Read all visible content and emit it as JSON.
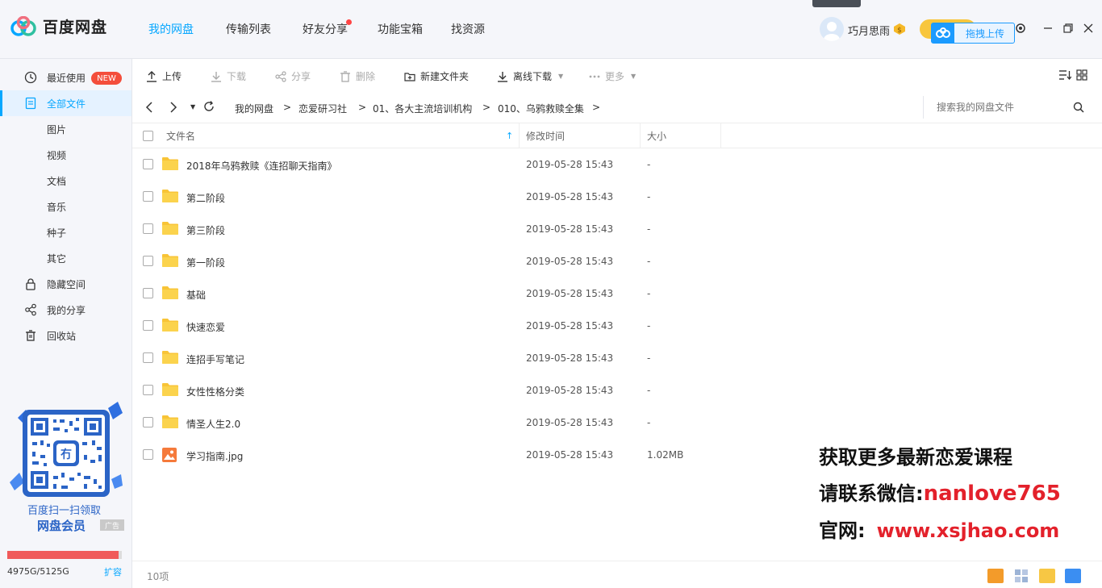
{
  "app": {
    "name": "百度网盘",
    "nav_tabs": [
      "我的网盘",
      "传输列表",
      "好友分享",
      "功能宝箱",
      "找资源"
    ],
    "active_tab": "我的网盘",
    "user": {
      "name": "巧月思雨"
    },
    "upload_float": "拖拽上传"
  },
  "sidebar": {
    "items": [
      {
        "label": "最近使用",
        "badge": "NEW"
      },
      {
        "label": "全部文件"
      },
      {
        "label": "图片"
      },
      {
        "label": "视频"
      },
      {
        "label": "文档"
      },
      {
        "label": "音乐"
      },
      {
        "label": "种子"
      },
      {
        "label": "其它"
      },
      {
        "label": "隐藏空间"
      },
      {
        "label": "我的分享"
      },
      {
        "label": "回收站"
      }
    ],
    "promo": {
      "line1": "百度扫一扫领取",
      "line2": "网盘会员",
      "ad": "广告"
    },
    "quota": {
      "text": "4975G/5125G",
      "used_fraction": 0.971,
      "expand": "扩容"
    }
  },
  "toolbar": {
    "upload": "上传",
    "download": "下载",
    "share": "分享",
    "delete": "删除",
    "new_folder": "新建文件夹",
    "offline_download": "离线下载",
    "more": "更多"
  },
  "breadcrumb": {
    "items": [
      "我的网盘",
      "恋爱研习社",
      "01、各大主流培训机构",
      "010、乌鸦救赎全集"
    ],
    "search_placeholder": "搜索我的网盘文件"
  },
  "table": {
    "headers": {
      "name": "文件名",
      "modified": "修改时间",
      "size": "大小"
    },
    "rows": [
      {
        "name": "2018年乌鸦救赎《连招聊天指南》",
        "modified": "2019-05-28 15:43",
        "size": "-",
        "type": "folder"
      },
      {
        "name": "第二阶段",
        "modified": "2019-05-28 15:43",
        "size": "-",
        "type": "folder"
      },
      {
        "name": "第三阶段",
        "modified": "2019-05-28 15:43",
        "size": "-",
        "type": "folder"
      },
      {
        "name": "第一阶段",
        "modified": "2019-05-28 15:43",
        "size": "-",
        "type": "folder"
      },
      {
        "name": "基础",
        "modified": "2019-05-28 15:43",
        "size": "-",
        "type": "folder"
      },
      {
        "name": "快速恋爱",
        "modified": "2019-05-28 15:43",
        "size": "-",
        "type": "folder"
      },
      {
        "name": "连招手写笔记",
        "modified": "2019-05-28 15:43",
        "size": "-",
        "type": "folder"
      },
      {
        "name": "女性性格分类",
        "modified": "2019-05-28 15:43",
        "size": "-",
        "type": "folder"
      },
      {
        "name": "情圣人生2.0",
        "modified": "2019-05-28 15:43",
        "size": "-",
        "type": "folder"
      },
      {
        "name": "学习指南.jpg",
        "modified": "2019-05-28 15:43",
        "size": "1.02MB",
        "type": "image"
      }
    ]
  },
  "watermark": {
    "line1": "获取更多最新恋爱课程",
    "line2_prefix": "请联系微信:",
    "line2_value": "nanlove765",
    "line3_prefix": "官网:",
    "line3_value": "www.xsjhao.com"
  },
  "status": {
    "count": "10项"
  },
  "colors": {
    "accent": "#06a7ff",
    "folder": "#f8c437",
    "badge": "#f44e3b"
  }
}
